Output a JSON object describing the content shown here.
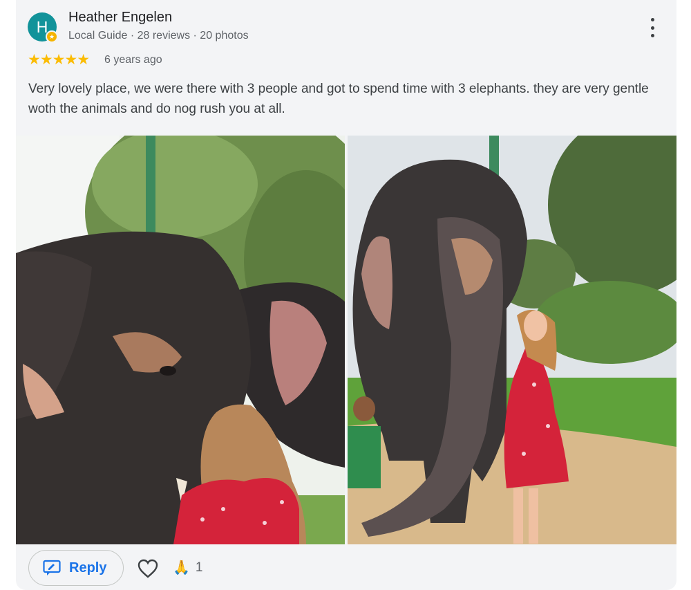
{
  "reviewer": {
    "initial": "H",
    "name": "Heather Engelen",
    "meta": "Local Guide · 28 reviews · 20 photos"
  },
  "review": {
    "rating": 5,
    "stars": "★★★★★",
    "time": "6 years ago",
    "text": "Very lovely place, we were there with 3 people and got to spend time with 3 elephants. they are very gentle woth the animals and do nog rush you at all."
  },
  "photos": [
    {
      "subject": "elephant-with-woman-back"
    },
    {
      "subject": "woman-with-elephant-trunk"
    }
  ],
  "actions": {
    "reply_label": "Reply",
    "reaction_emoji": "🙏",
    "reaction_count": "1"
  },
  "icons": {
    "more": "more-vert-icon",
    "reply": "reply-edit-icon",
    "like": "heart-outline-icon"
  },
  "colors": {
    "avatar": "#12939a",
    "star": "#fbbc04",
    "accent": "#1a73e8",
    "card_bg": "#f3f4f6"
  }
}
